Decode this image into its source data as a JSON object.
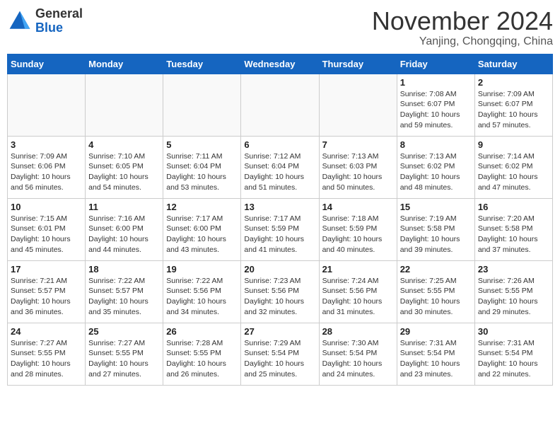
{
  "header": {
    "logo_line1": "General",
    "logo_line2": "Blue",
    "month": "November 2024",
    "location": "Yanjing, Chongqing, China"
  },
  "weekdays": [
    "Sunday",
    "Monday",
    "Tuesday",
    "Wednesday",
    "Thursday",
    "Friday",
    "Saturday"
  ],
  "weeks": [
    [
      {
        "day": "",
        "info": ""
      },
      {
        "day": "",
        "info": ""
      },
      {
        "day": "",
        "info": ""
      },
      {
        "day": "",
        "info": ""
      },
      {
        "day": "",
        "info": ""
      },
      {
        "day": "1",
        "info": "Sunrise: 7:08 AM\nSunset: 6:07 PM\nDaylight: 10 hours\nand 59 minutes."
      },
      {
        "day": "2",
        "info": "Sunrise: 7:09 AM\nSunset: 6:07 PM\nDaylight: 10 hours\nand 57 minutes."
      }
    ],
    [
      {
        "day": "3",
        "info": "Sunrise: 7:09 AM\nSunset: 6:06 PM\nDaylight: 10 hours\nand 56 minutes."
      },
      {
        "day": "4",
        "info": "Sunrise: 7:10 AM\nSunset: 6:05 PM\nDaylight: 10 hours\nand 54 minutes."
      },
      {
        "day": "5",
        "info": "Sunrise: 7:11 AM\nSunset: 6:04 PM\nDaylight: 10 hours\nand 53 minutes."
      },
      {
        "day": "6",
        "info": "Sunrise: 7:12 AM\nSunset: 6:04 PM\nDaylight: 10 hours\nand 51 minutes."
      },
      {
        "day": "7",
        "info": "Sunrise: 7:13 AM\nSunset: 6:03 PM\nDaylight: 10 hours\nand 50 minutes."
      },
      {
        "day": "8",
        "info": "Sunrise: 7:13 AM\nSunset: 6:02 PM\nDaylight: 10 hours\nand 48 minutes."
      },
      {
        "day": "9",
        "info": "Sunrise: 7:14 AM\nSunset: 6:02 PM\nDaylight: 10 hours\nand 47 minutes."
      }
    ],
    [
      {
        "day": "10",
        "info": "Sunrise: 7:15 AM\nSunset: 6:01 PM\nDaylight: 10 hours\nand 45 minutes."
      },
      {
        "day": "11",
        "info": "Sunrise: 7:16 AM\nSunset: 6:00 PM\nDaylight: 10 hours\nand 44 minutes."
      },
      {
        "day": "12",
        "info": "Sunrise: 7:17 AM\nSunset: 6:00 PM\nDaylight: 10 hours\nand 43 minutes."
      },
      {
        "day": "13",
        "info": "Sunrise: 7:17 AM\nSunset: 5:59 PM\nDaylight: 10 hours\nand 41 minutes."
      },
      {
        "day": "14",
        "info": "Sunrise: 7:18 AM\nSunset: 5:59 PM\nDaylight: 10 hours\nand 40 minutes."
      },
      {
        "day": "15",
        "info": "Sunrise: 7:19 AM\nSunset: 5:58 PM\nDaylight: 10 hours\nand 39 minutes."
      },
      {
        "day": "16",
        "info": "Sunrise: 7:20 AM\nSunset: 5:58 PM\nDaylight: 10 hours\nand 37 minutes."
      }
    ],
    [
      {
        "day": "17",
        "info": "Sunrise: 7:21 AM\nSunset: 5:57 PM\nDaylight: 10 hours\nand 36 minutes."
      },
      {
        "day": "18",
        "info": "Sunrise: 7:22 AM\nSunset: 5:57 PM\nDaylight: 10 hours\nand 35 minutes."
      },
      {
        "day": "19",
        "info": "Sunrise: 7:22 AM\nSunset: 5:56 PM\nDaylight: 10 hours\nand 34 minutes."
      },
      {
        "day": "20",
        "info": "Sunrise: 7:23 AM\nSunset: 5:56 PM\nDaylight: 10 hours\nand 32 minutes."
      },
      {
        "day": "21",
        "info": "Sunrise: 7:24 AM\nSunset: 5:56 PM\nDaylight: 10 hours\nand 31 minutes."
      },
      {
        "day": "22",
        "info": "Sunrise: 7:25 AM\nSunset: 5:55 PM\nDaylight: 10 hours\nand 30 minutes."
      },
      {
        "day": "23",
        "info": "Sunrise: 7:26 AM\nSunset: 5:55 PM\nDaylight: 10 hours\nand 29 minutes."
      }
    ],
    [
      {
        "day": "24",
        "info": "Sunrise: 7:27 AM\nSunset: 5:55 PM\nDaylight: 10 hours\nand 28 minutes."
      },
      {
        "day": "25",
        "info": "Sunrise: 7:27 AM\nSunset: 5:55 PM\nDaylight: 10 hours\nand 27 minutes."
      },
      {
        "day": "26",
        "info": "Sunrise: 7:28 AM\nSunset: 5:55 PM\nDaylight: 10 hours\nand 26 minutes."
      },
      {
        "day": "27",
        "info": "Sunrise: 7:29 AM\nSunset: 5:54 PM\nDaylight: 10 hours\nand 25 minutes."
      },
      {
        "day": "28",
        "info": "Sunrise: 7:30 AM\nSunset: 5:54 PM\nDaylight: 10 hours\nand 24 minutes."
      },
      {
        "day": "29",
        "info": "Sunrise: 7:31 AM\nSunset: 5:54 PM\nDaylight: 10 hours\nand 23 minutes."
      },
      {
        "day": "30",
        "info": "Sunrise: 7:31 AM\nSunset: 5:54 PM\nDaylight: 10 hours\nand 22 minutes."
      }
    ]
  ]
}
